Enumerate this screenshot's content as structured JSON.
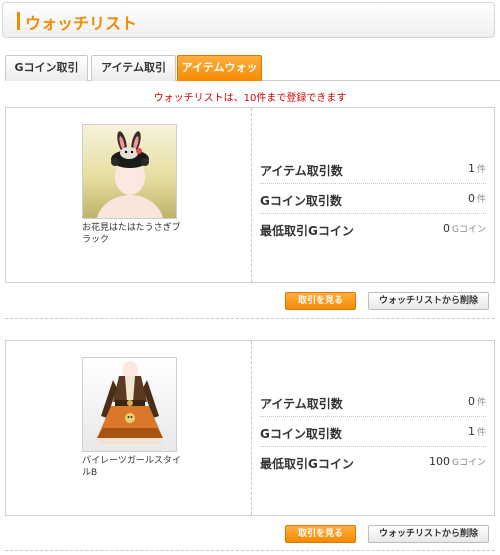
{
  "header": {
    "title": "ウォッチリスト"
  },
  "tabs": [
    {
      "label": "Gコイン取引",
      "active": false
    },
    {
      "label": "アイテム取引",
      "active": false
    },
    {
      "label": "アイテムウォッチ",
      "active": true
    }
  ],
  "notice": "ウォッチリストは、10件まで登録できます",
  "items": [
    {
      "name": "お花見はたはたうさぎブラック",
      "stats": [
        {
          "label": "アイテム取引数",
          "value": "1",
          "unit": "件"
        },
        {
          "label": "Gコイン取引数",
          "value": "0",
          "unit": "件"
        },
        {
          "label": "最低取引Gコイン",
          "value": "0",
          "unit": "Gコイン"
        }
      ],
      "buttons": {
        "view": "取引を見る",
        "delete": "ウォッチリストから削除"
      }
    },
    {
      "name": "パイレーツガールスタイルB",
      "stats": [
        {
          "label": "アイテム取引数",
          "value": "0",
          "unit": "件"
        },
        {
          "label": "Gコイン取引数",
          "value": "1",
          "unit": "件"
        },
        {
          "label": "最低取引Gコイン",
          "value": "100",
          "unit": "Gコイン"
        }
      ],
      "buttons": {
        "view": "取引を見る",
        "delete": "ウォッチリストから削除"
      }
    }
  ],
  "colors": {
    "accent": "#f08c00",
    "notice": "#d20000"
  }
}
